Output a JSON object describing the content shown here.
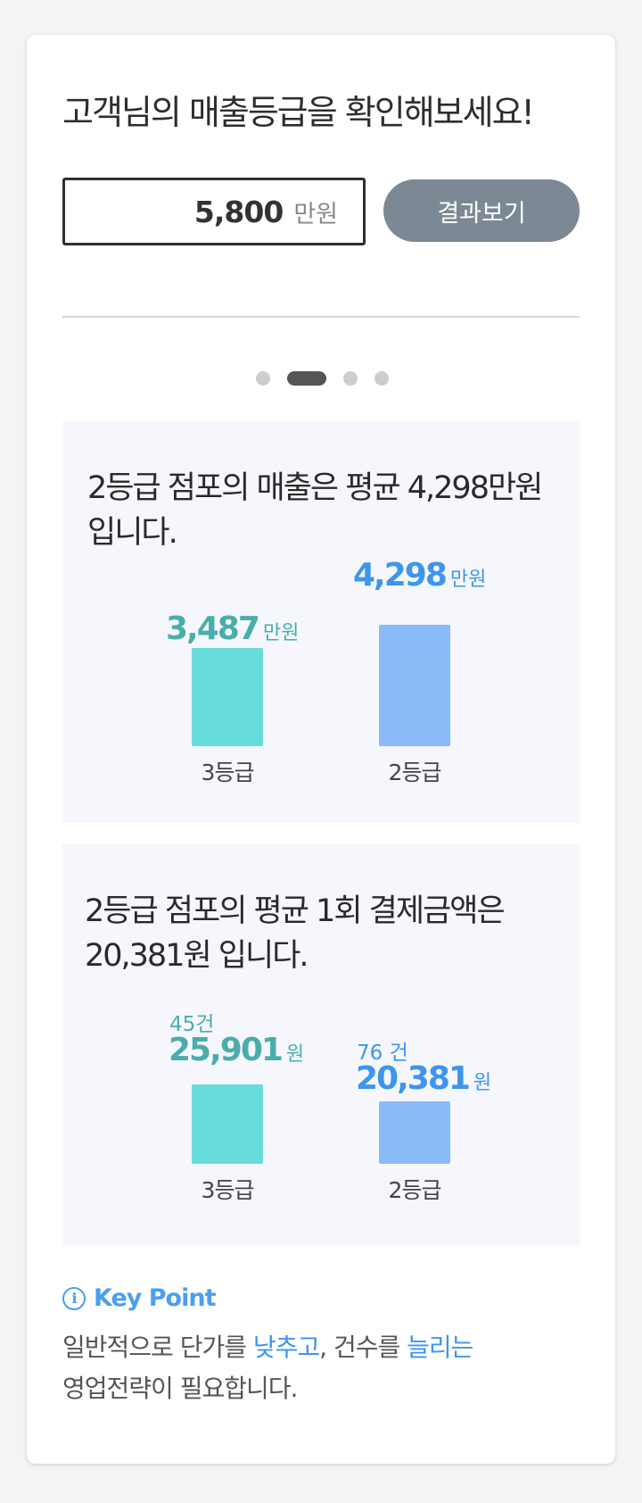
{
  "header": {
    "title": "고객님의 매출등급을 확인해보세요!"
  },
  "input": {
    "value": "5,800",
    "unit": "만원"
  },
  "result_button": {
    "label": "결과보기"
  },
  "pager": {
    "count": 4,
    "active_index": 1
  },
  "panels": [
    {
      "title": "2등급 점포의 매출은 평균 4,298만원 입니다.",
      "bars": [
        {
          "grade": "3등급",
          "value": "3,487",
          "unit": "만원",
          "numeric": 3487,
          "color": "#68dcdc"
        },
        {
          "grade": "2등급",
          "value": "4,298",
          "unit": "만원",
          "numeric": 4298,
          "color": "#8bbaf8"
        }
      ]
    },
    {
      "title": "2등급 점포의 평균 1회 결제금액은 20,381원 입니다.",
      "bars": [
        {
          "grade": "3등급",
          "count": "45건",
          "value": "25,901",
          "unit": "원",
          "numeric": 25901,
          "color": "#68dcdc"
        },
        {
          "grade": "2등급",
          "count": "76 건",
          "value": "20,381",
          "unit": "원",
          "numeric": 20381,
          "color": "#8bbaf8"
        }
      ]
    }
  ],
  "keypoint": {
    "icon": "info-circle-icon",
    "heading": "Key Point",
    "body": {
      "part1": "일반적으로 단가를 ",
      "hl1": "낮추고",
      "part2": ", 건수를 ",
      "hl2": "늘리는",
      "part3": "영업전략이 필요합니다."
    }
  },
  "colors": {
    "accent_blue": "#3d95ee",
    "accent_teal": "#49aeab",
    "button_gray": "#7c8994"
  }
}
